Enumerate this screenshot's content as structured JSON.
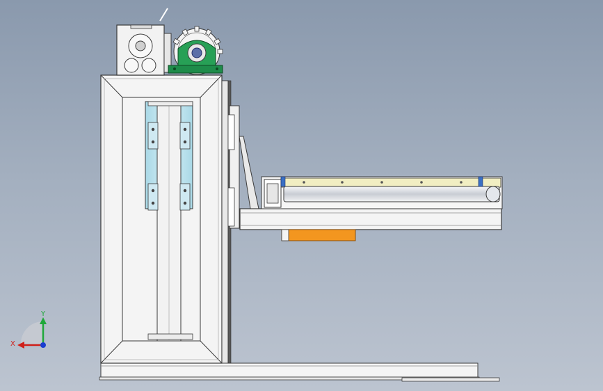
{
  "viewport": {
    "background_top": "#8a99ad",
    "background_bottom": "#bcc4d0"
  },
  "colors": {
    "frame_fill": "#f4f4f4",
    "frame_edge": "#3a3a3a",
    "rail_blue": "#bfe4ef",
    "bearing_block_green": "#1e8c4a",
    "belt_yellow": "#f1eec2",
    "plate_orange": "#f3961f",
    "roller_gray": "#d9dce2"
  },
  "triad": {
    "x_label": "X",
    "y_label": "Y",
    "x_color": "#d0201a",
    "y_color": "#1fa83a",
    "z_color": "#1a3fd0",
    "icons": [
      "axis-triad-icon"
    ]
  }
}
